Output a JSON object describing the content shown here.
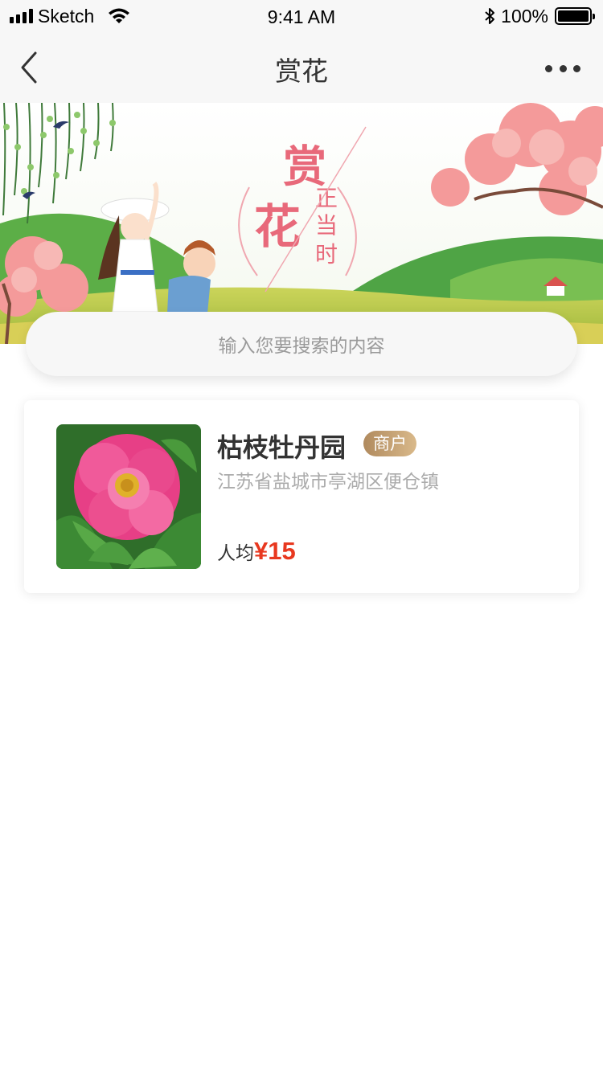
{
  "status_bar": {
    "carrier": "Sketch",
    "time": "9:41 AM",
    "battery_percent": "100%",
    "battery_level": 1.0,
    "icons": [
      "signal-icon",
      "wifi-icon",
      "bluetooth-icon",
      "battery-icon"
    ]
  },
  "nav": {
    "title": "赏花",
    "back_icon": "chevron-left-icon",
    "more_icon": "more-horizontal-icon"
  },
  "banner": {
    "title_big_1": "赏",
    "title_big_2": "花",
    "title_small_1": "正",
    "title_small_2": "当",
    "title_small_3": "时"
  },
  "search": {
    "placeholder": "输入您要搜索的内容",
    "icon": "search-field"
  },
  "listings": [
    {
      "name": "枯枝牡丹园",
      "badge": "商户",
      "address": "江苏省盐城市亭湖区便仓镇",
      "price_label": "人均",
      "price": "¥15",
      "image": "peony-flower-photo"
    }
  ],
  "colors": {
    "nav_bg": "#f7f7f7",
    "accent_price": "#e8381f",
    "badge_gold": "#c4a071",
    "banner_pink": "#e8697a"
  }
}
